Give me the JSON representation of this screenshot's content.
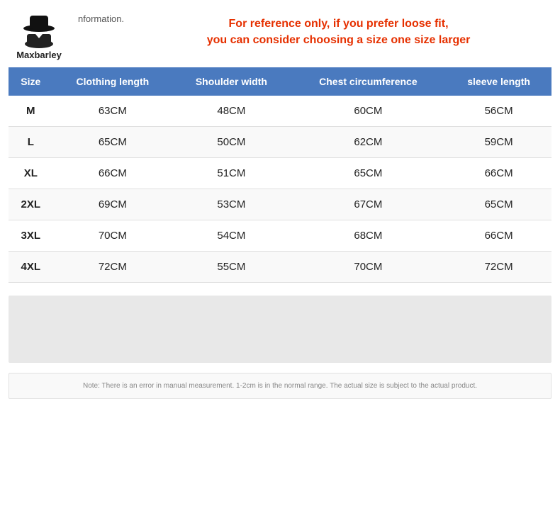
{
  "brand": {
    "name": "Maxbarley",
    "info_label": "nformation."
  },
  "notice": {
    "line1": "For reference only, if you prefer loose fit,",
    "line2": "you can consider choosing a size one size larger"
  },
  "table": {
    "headers": [
      "Size",
      "Clothing length",
      "Shoulder width",
      "Chest circumference",
      "sleeve length"
    ],
    "rows": [
      {
        "size": "M",
        "clothing_length": "63CM",
        "shoulder_width": "48CM",
        "chest_circumference": "60CM",
        "sleeve_length": "56CM"
      },
      {
        "size": "L",
        "clothing_length": "65CM",
        "shoulder_width": "50CM",
        "chest_circumference": "62CM",
        "sleeve_length": "59CM"
      },
      {
        "size": "XL",
        "clothing_length": "66CM",
        "shoulder_width": "51CM",
        "chest_circumference": "65CM",
        "sleeve_length": "66CM"
      },
      {
        "size": "2XL",
        "clothing_length": "69CM",
        "shoulder_width": "53CM",
        "chest_circumference": "67CM",
        "sleeve_length": "65CM"
      },
      {
        "size": "3XL",
        "clothing_length": "70CM",
        "shoulder_width": "54CM",
        "chest_circumference": "68CM",
        "sleeve_length": "66CM"
      },
      {
        "size": "4XL",
        "clothing_length": "72CM",
        "shoulder_width": "55CM",
        "chest_circumference": "70CM",
        "sleeve_length": "72CM"
      }
    ]
  },
  "note": {
    "text": "Note: There is an error in manual measurement. 1-2cm is in the normal range. The actual size is subject to the actual product."
  }
}
